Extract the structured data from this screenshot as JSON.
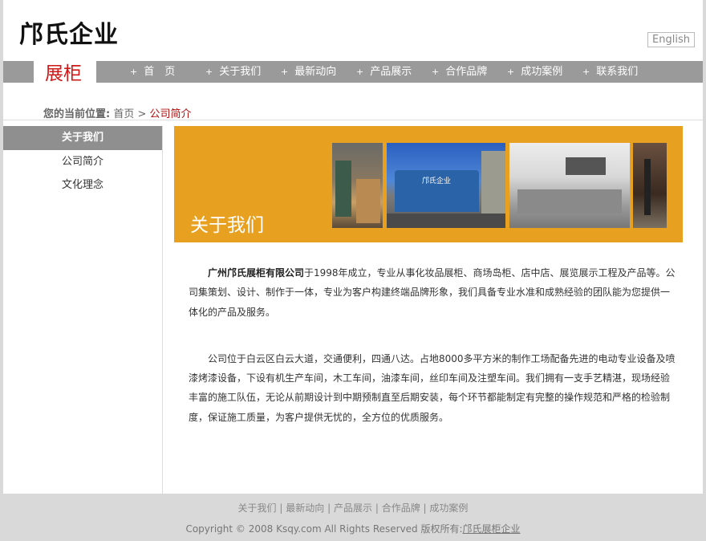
{
  "header": {
    "logo": "邝氏企业",
    "lang_button": "English",
    "brand": "展柜"
  },
  "nav": {
    "items": [
      {
        "label": "首　页"
      },
      {
        "label": "关于我们"
      },
      {
        "label": "最新动向"
      },
      {
        "label": "产品展示"
      },
      {
        "label": "合作品牌"
      },
      {
        "label": "成功案例"
      },
      {
        "label": "联系我们"
      }
    ]
  },
  "breadcrumb": {
    "label": "您的当前位置:",
    "home": "首页",
    "sep": ">",
    "current": "公司简介"
  },
  "sidebar": {
    "title": "关于我们",
    "items": [
      {
        "label": "公司简介"
      },
      {
        "label": "文化理念"
      }
    ]
  },
  "banner": {
    "title": "关于我们",
    "sign_text": "邝氏企业"
  },
  "content": {
    "p1_bold": "广州邝氏展柜有限公司",
    "p1_rest": "于1998年成立，专业从事化妆品展柜、商场岛柜、店中店、展览展示工程及产品等。公司集策划、设计、制作于一体，专业为客户构建终端品牌形象，我们具备专业水准和成熟经验的团队能为您提供一体化的产品及服务。",
    "p2": "公司位于白云区白云大道，交通便利，四通八达。占地8000多平方米的制作工场配备先进的电动专业设备及喷漆烤漆设备，下设有机生产车间，木工车间，油漆车间，丝印车间及注塑车间。我们拥有一支手艺精湛，现场经验丰富的施工队伍，无论从前期设计到中期预制直至后期安装，每个环节都能制定有完整的操作规范和严格的检验制度，保证施工质量，为客户提供无忧的，全方位的优质服务。"
  },
  "footer": {
    "links": [
      {
        "label": "关于我们"
      },
      {
        "label": "最新动向"
      },
      {
        "label": "产品展示"
      },
      {
        "label": "合作品牌"
      },
      {
        "label": "成功案例"
      }
    ],
    "link_sep": "|",
    "copyright": "Copyright © 2008 Ksqy.com All Rights Reserved 版权所有:",
    "company": "邝氏展柜企业"
  },
  "colors": {
    "accent_red": "#d01818",
    "nav_gray": "#9a9a9a",
    "banner_orange": "#e8a020"
  },
  "icons": {
    "nav_bullet": "plus-icon"
  }
}
